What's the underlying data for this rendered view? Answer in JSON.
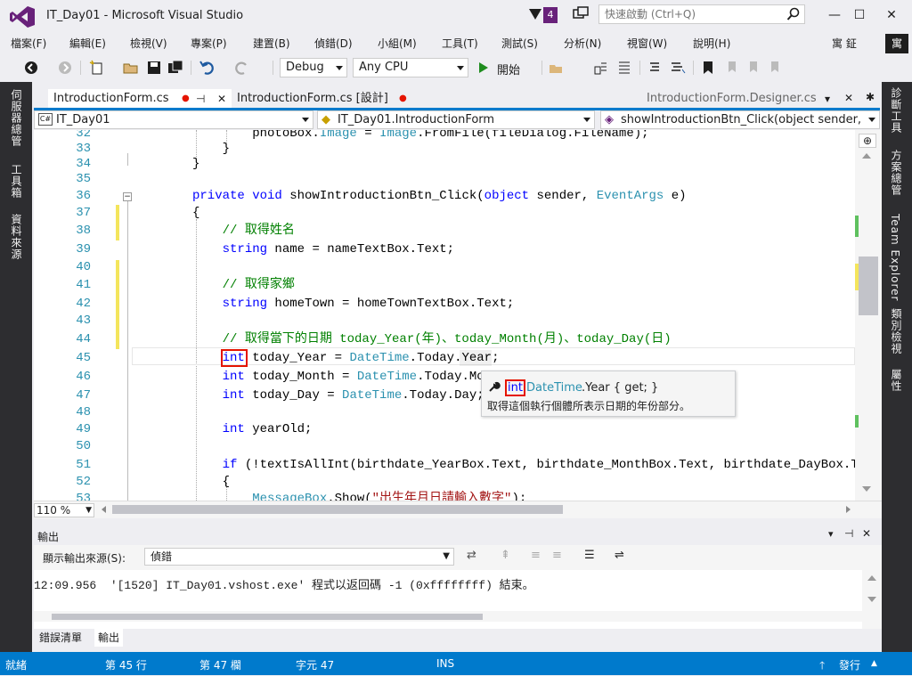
{
  "window": {
    "title": "IT_Day01 - Microsoft Visual Studio",
    "notification_count": "4",
    "quick_launch_placeholder": "快速啟動 (Ctrl+Q)",
    "controls": {
      "minimize": "—",
      "maximize": "☐",
      "close": "✕"
    }
  },
  "menu": [
    "檔案(F)",
    "編輯(E)",
    "檢視(V)",
    "專案(P)",
    "建置(B)",
    "偵錯(D)",
    "小組(M)",
    "工具(T)",
    "測試(S)",
    "分析(N)",
    "視窗(W)",
    "說明(H)"
  ],
  "user": {
    "name": "寓 鉦",
    "avatar": "寓"
  },
  "toolbar": {
    "config": "Debug",
    "platform": "Any CPU",
    "start": "開始"
  },
  "left_tabs": [
    "伺服器總管",
    "工具箱",
    "資料來源"
  ],
  "right_tabs": [
    "診斷工具",
    "方案總管",
    "Team Explorer",
    "類別檢視",
    "屬性"
  ],
  "doc_tabs": [
    {
      "label": "IntroductionForm.cs",
      "active": true,
      "pin": "⊣",
      "close": "✕"
    },
    {
      "label": "IntroductionForm.cs [設計]",
      "active": false
    },
    {
      "label": "IntroductionForm.Designer.cs",
      "active": false,
      "close": "✕"
    }
  ],
  "navbar": {
    "project": "IT_Day01",
    "class": "IT_Day01.IntroductionForm",
    "member": "showIntroductionBtn_Click(object sender,"
  },
  "editor": {
    "line_numbers": [
      "32",
      "33",
      "34",
      "35",
      "36",
      "37",
      "38",
      "39",
      "40",
      "41",
      "42",
      "43",
      "44",
      "45",
      "46",
      "47",
      "48",
      "49",
      "50",
      "51",
      "52",
      "53"
    ],
    "zoom": "110 %"
  },
  "code_lines": [
    {
      "ln": "32",
      "text": "        photoBox.Image = Image.FromFile(fileDialog.FileName);"
    },
    {
      "ln": "33",
      "text": "    }"
    },
    {
      "ln": "34",
      "text": "}"
    },
    {
      "ln": "36",
      "text": "private void showIntroductionBtn_Click(object sender, EventArgs e)"
    },
    {
      "ln": "37",
      "text": "{"
    },
    {
      "ln": "38",
      "text": "    // 取得姓名"
    },
    {
      "ln": "39",
      "text": "    string name = nameTextBox.Text;"
    },
    {
      "ln": "41",
      "text": "    // 取得家鄉"
    },
    {
      "ln": "42",
      "text": "    string homeTown = homeTownTextBox.Text;"
    },
    {
      "ln": "44",
      "text": "    // 取得當下的日期 today_Year(年)、today_Month(月)、today_Day(日)"
    },
    {
      "ln": "45",
      "text": "    int today_Year = DateTime.Today.Year;"
    },
    {
      "ln": "46",
      "text": "    int today_Month = DateTime.Today.Month;"
    },
    {
      "ln": "47",
      "text": "    int today_Day = DateTime.Today.Day;"
    },
    {
      "ln": "49",
      "text": "    int yearOld;"
    },
    {
      "ln": "51",
      "text": "    if (!textIsAllInt(birthdate_YearBox.Text, birthdate_MonthBox.Text, birthdate_DayBox.Text"
    },
    {
      "ln": "52",
      "text": "    {"
    },
    {
      "ln": "53",
      "text": "        MessageBox.Show(\"出生年月日請輸入數字\");"
    }
  ],
  "tooltip": {
    "kw": "int",
    "sig_type": "DateTime",
    "sig_rest": ".Year { get; }",
    "description": "取得這個執行個體所表示日期的年份部分。"
  },
  "output": {
    "title": "輸出",
    "source_label": "顯示輸出來源(S):",
    "source_value": "偵錯",
    "text": "12:09.956  '[1520] IT_Day01.vshost.exe' 程式以返回碼 -1 (0xffffffff) 結束。"
  },
  "bottom_tabs": [
    "錯誤清單",
    "輸出"
  ],
  "status": {
    "ready": "就緒",
    "line": "第 45 行",
    "col": "第 47 欄",
    "ch": "字元 47",
    "ins": "INS",
    "publish": "發行"
  },
  "colors": {
    "accent": "#007acc",
    "vs_purple": "#68217a",
    "keyword": "#0000ff",
    "type": "#2b91af",
    "comment": "#008000",
    "string": "#a31515",
    "change_bar": "#f4e55c",
    "highlight_box": "#e51400"
  }
}
